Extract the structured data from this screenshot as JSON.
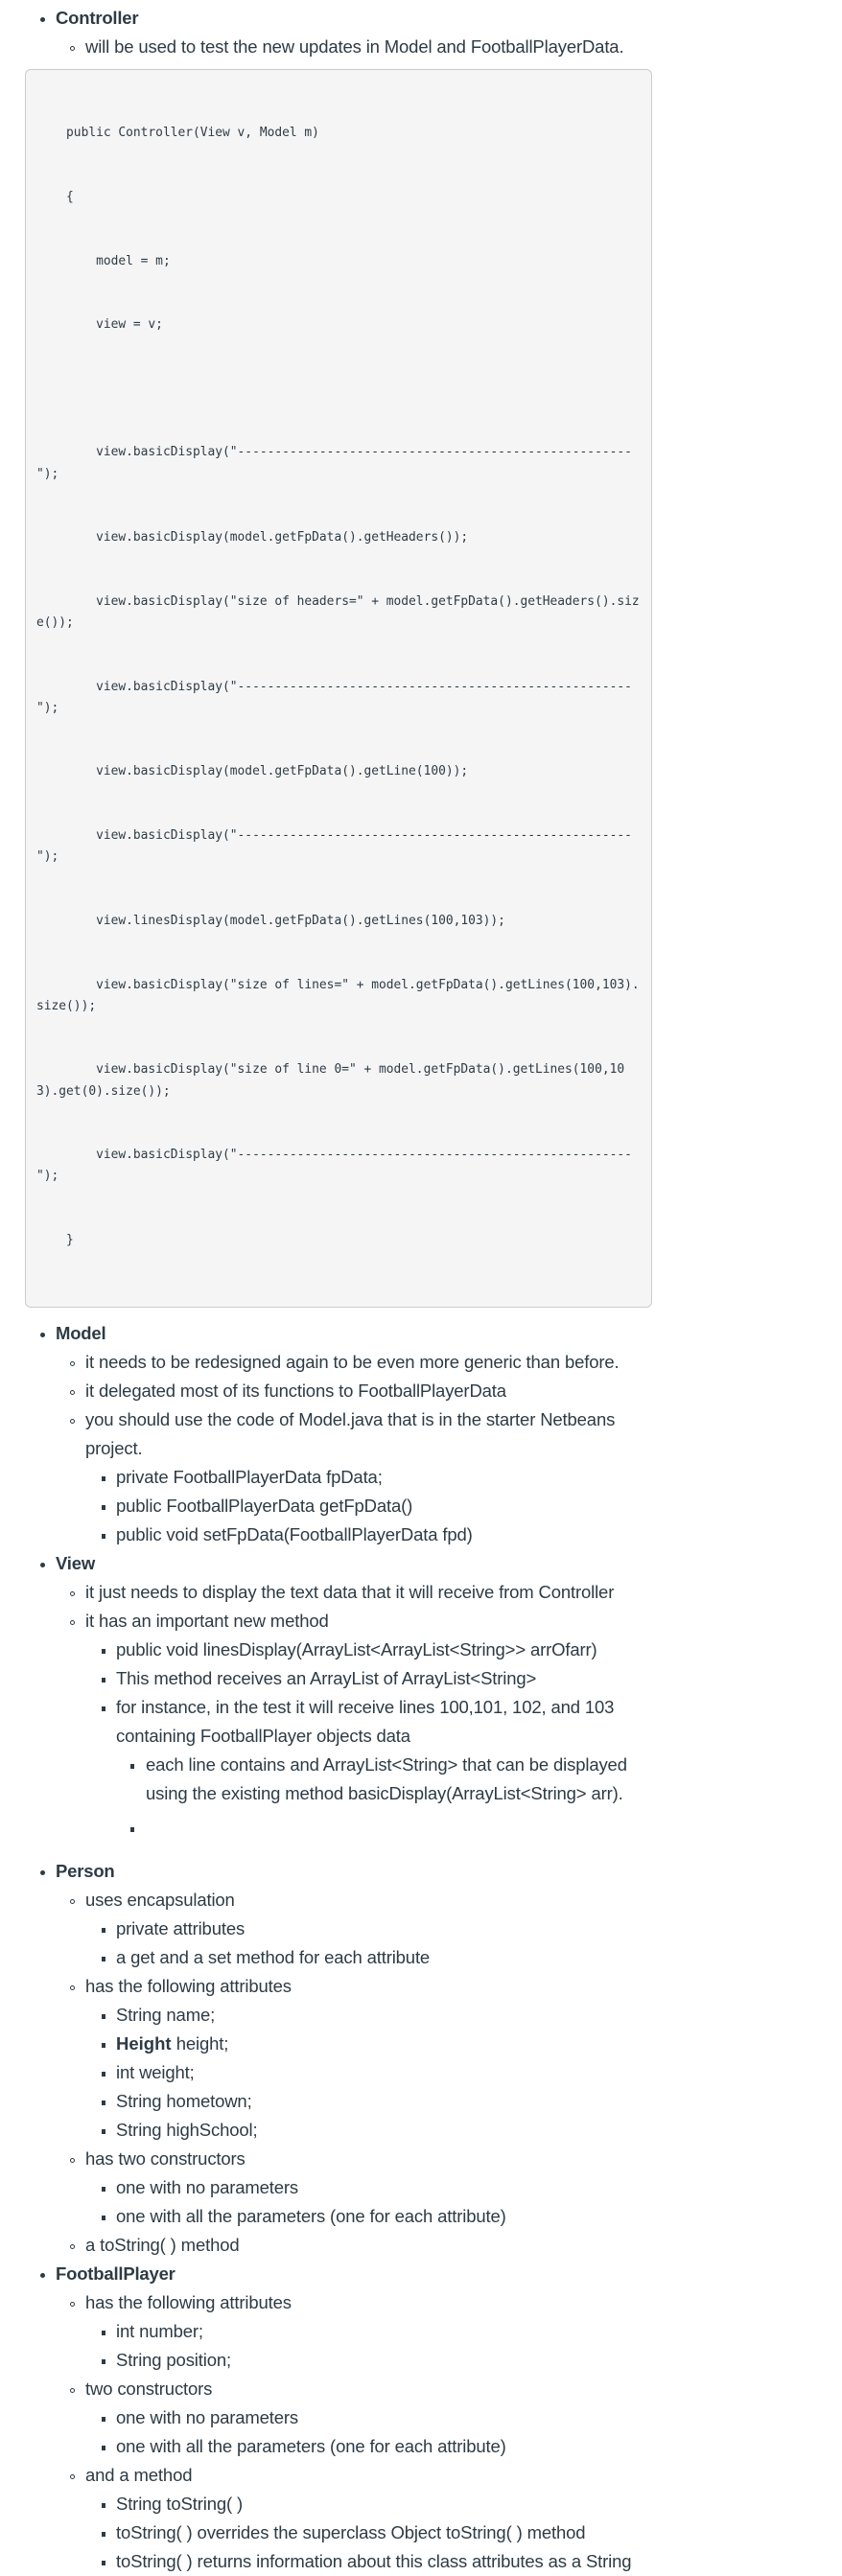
{
  "sections": [
    {
      "title": "Controller",
      "items": [
        {
          "text": "will be used to test the new updates in Model and FootballPlayerData."
        }
      ],
      "code": [
        "    public Controller(View v, Model m)",
        "    {",
        "        model = m;",
        "        view = v;",
        "",
        "        view.basicDisplay(\"-----------------------------------------------------\");",
        "        view.basicDisplay(model.getFpData().getHeaders());",
        "        view.basicDisplay(\"size of headers=\" + model.getFpData().getHeaders().size());",
        "        view.basicDisplay(\"-----------------------------------------------------\");",
        "        view.basicDisplay(model.getFpData().getLine(100));",
        "        view.basicDisplay(\"-----------------------------------------------------\");",
        "        view.linesDisplay(model.getFpData().getLines(100,103));",
        "        view.basicDisplay(\"size of lines=\" + model.getFpData().getLines(100,103).size());",
        "        view.basicDisplay(\"size of line 0=\" + model.getFpData().getLines(100,103).get(0).size());",
        "        view.basicDisplay(\"-----------------------------------------------------\");",
        "    }"
      ]
    },
    {
      "title": "Model",
      "items": [
        {
          "text": "it needs to be redesigned again to be even more generic than before."
        },
        {
          "text": "it delegated most of its functions to FootballPlayerData"
        },
        {
          "text": "you should use the code of Model.java that is in the starter Netbeans project.",
          "sub": [
            "private FootballPlayerData fpData;",
            "public FootballPlayerData getFpData()",
            "public void setFpData(FootballPlayerData fpd)"
          ]
        }
      ]
    },
    {
      "title": "View",
      "items": [
        {
          "text": "it just needs to display the text data that it will receive from Controller"
        },
        {
          "text": "it has an important new method",
          "sub": [
            "public void linesDisplay(ArrayList<ArrayList<String>> arrOfarr)",
            "This method receives an ArrayList of ArrayList<String>",
            "for instance, in the test it will receive lines 100,101, 102, and 103 containing FootballPlayer objects data"
          ],
          "subsub": [
            "each line contains and ArrayList<String> that can be displayed using the existing method basicDisplay(ArrayList<String> arr).",
            ""
          ]
        }
      ]
    },
    {
      "title": "Person",
      "items": [
        {
          "text": "uses encapsulation",
          "sub": [
            "private attributes",
            "a get and a set method for each attribute"
          ]
        },
        {
          "text": "has the following attributes",
          "sub": [
            "String name;",
            "height;",
            "int weight;",
            "String hometown;",
            "String highSchool;"
          ],
          "bold_prefix": "Height"
        },
        {
          "text": "has two constructors",
          "sub": [
            "one with no parameters",
            "one with all the parameters (one for each attribute)"
          ]
        },
        {
          "text": "a toString( ) method"
        }
      ]
    },
    {
      "title": "FootballPlayer",
      "items": [
        {
          "text": "has the following attributes",
          "sub": [
            "int number;",
            "String position;"
          ]
        },
        {
          "text": "two constructors",
          "sub": [
            "one with no parameters",
            "one with all the parameters (one for each attribute)"
          ]
        },
        {
          "text": "and a method",
          "sub": [
            "String toString( )",
            "toString( ) overrides the superclass Object toString( ) method",
            "toString( ) returns information about this class attributes as a String"
          ]
        }
      ]
    }
  ]
}
